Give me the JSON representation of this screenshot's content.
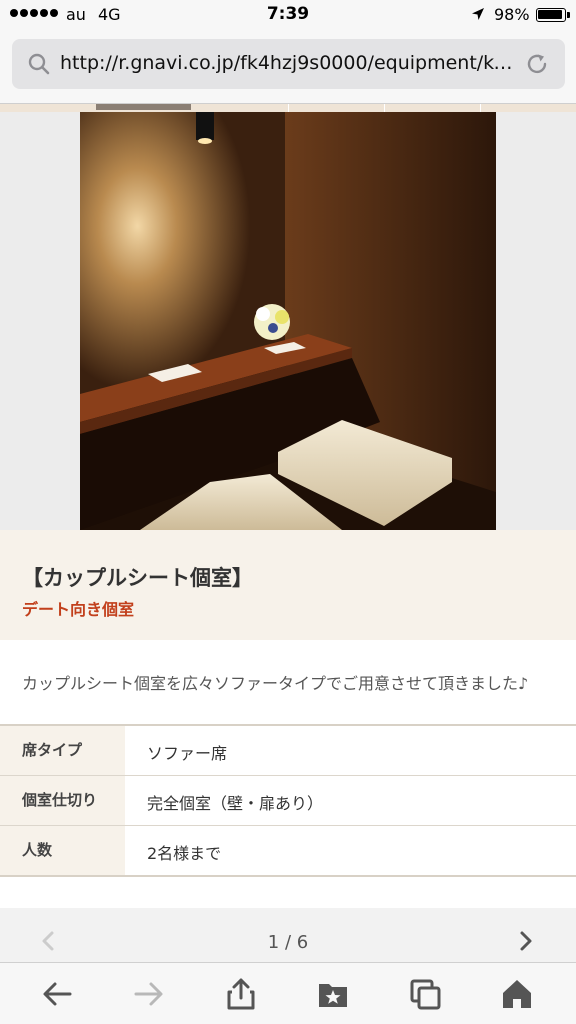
{
  "status_bar": {
    "carrier": "au",
    "network": "4G",
    "time": "7:39",
    "battery": "98%"
  },
  "browser": {
    "url": "http://r.gnavi.co.jp/fk4hzj9s0000/equipment/ko…"
  },
  "room": {
    "title": "【カップルシート個室】",
    "subtitle": "デート向き個室",
    "description": "カップルシート個室を広々ソファータイプでご用意させて頂きました♪",
    "specs": [
      {
        "label": "席タイプ",
        "value": "ソファー席"
      },
      {
        "label": "個室仕切り",
        "value": "完全個室（壁・扉あり）"
      },
      {
        "label": "人数",
        "value": "2名様まで"
      }
    ]
  },
  "pager": {
    "current_label": "1 / 6"
  },
  "colors": {
    "accent_red": "#c2401c",
    "beige_panel": "#f7f2ea",
    "tab_active": "#8b7f74"
  }
}
